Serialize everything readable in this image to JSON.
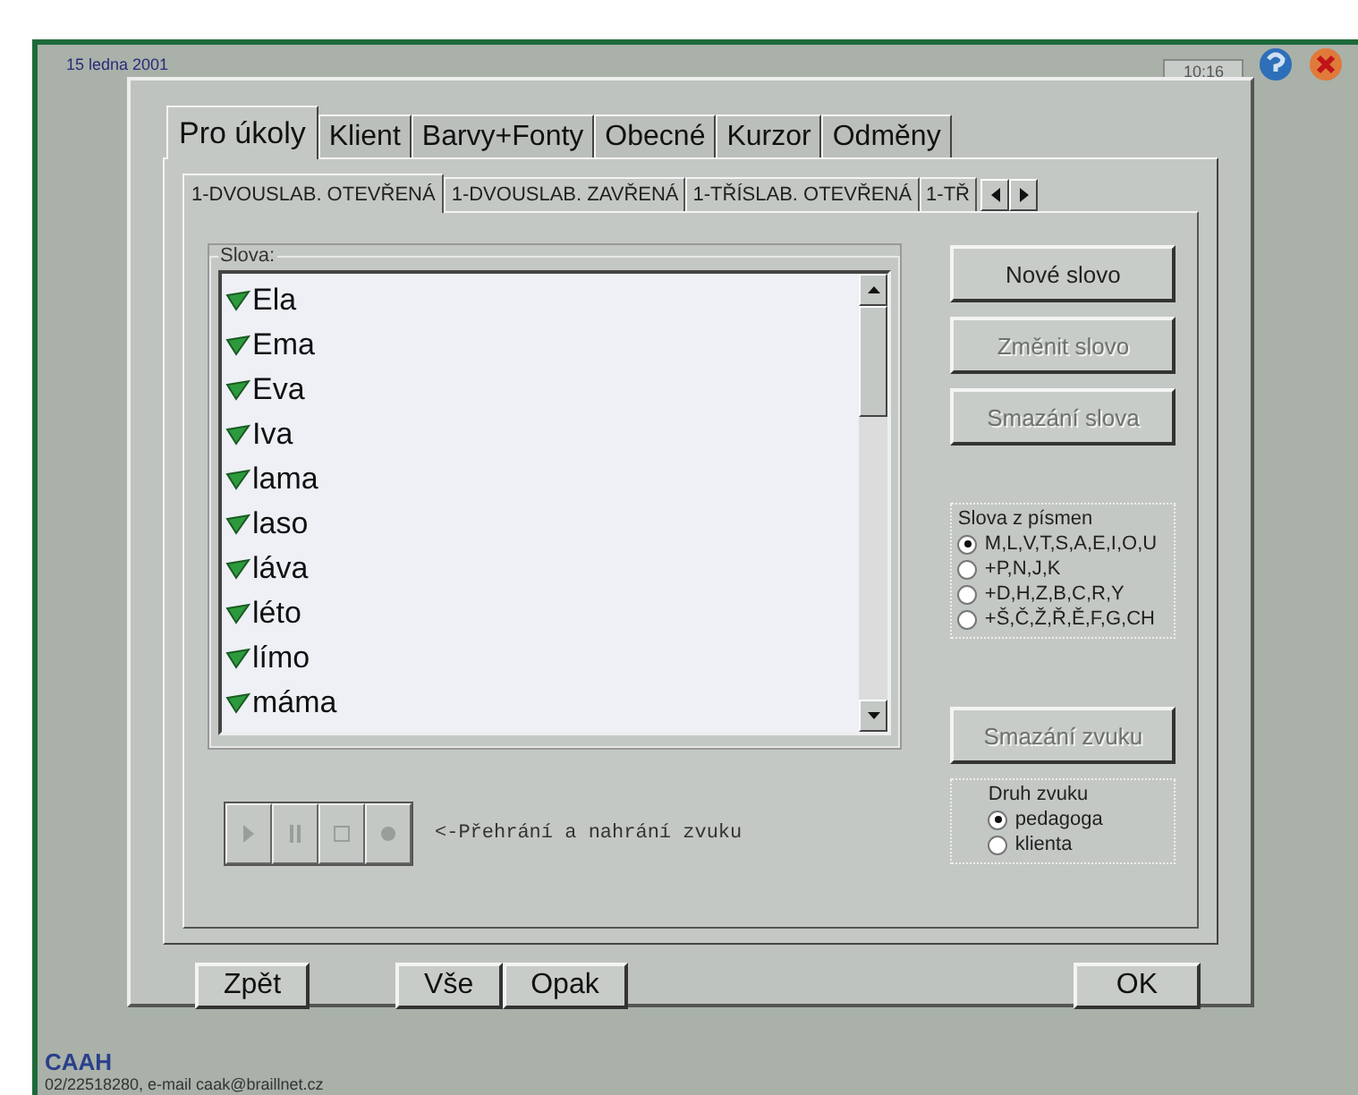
{
  "header": {
    "date": "15 ledna 2001",
    "time": "10:16"
  },
  "tabs": [
    {
      "label": "Pro úkoly",
      "selected": true
    },
    {
      "label": "Klient",
      "selected": false
    },
    {
      "label": "Barvy+Fonty",
      "selected": false
    },
    {
      "label": "Obecné",
      "selected": false
    },
    {
      "label": "Kurzor",
      "selected": false
    },
    {
      "label": "Odměny",
      "selected": false
    }
  ],
  "subtabs": [
    {
      "label": "1-DVOUSLAB. OTEVŘENÁ",
      "selected": true
    },
    {
      "label": "1-DVOUSLAB. ZAVŘENÁ",
      "selected": false
    },
    {
      "label": "1-TŘÍSLAB. OTEVŘENÁ",
      "selected": false
    },
    {
      "label": "1-TŘ",
      "selected": false
    }
  ],
  "words": {
    "label": "Slova:",
    "items": [
      {
        "text": "Ela",
        "checked": true
      },
      {
        "text": "Ema",
        "checked": true
      },
      {
        "text": "Eva",
        "checked": true
      },
      {
        "text": "Iva",
        "checked": true
      },
      {
        "text": "lama",
        "checked": true
      },
      {
        "text": "laso",
        "checked": true
      },
      {
        "text": "láva",
        "checked": true
      },
      {
        "text": "léto",
        "checked": true
      },
      {
        "text": "límo",
        "checked": true
      },
      {
        "text": "máma",
        "checked": true
      }
    ]
  },
  "word_buttons": [
    {
      "label": "Nové slovo",
      "disabled": false
    },
    {
      "label": "Změnit slovo",
      "disabled": true
    },
    {
      "label": "Smazání slova",
      "disabled": true
    }
  ],
  "letters": {
    "label": "Slova z písmen",
    "options": [
      {
        "label": "M,L,V,T,S,A,E,I,O,U",
        "selected": true
      },
      {
        "label": "+P,N,J,K",
        "selected": false
      },
      {
        "label": "+D,H,Z,B,C,R,Y",
        "selected": false
      },
      {
        "label": "+Š,Č,Ž,Ř,Ě,F,G,CH",
        "selected": false
      }
    ]
  },
  "sound_button": {
    "label": "Smazání zvuku",
    "disabled": true
  },
  "sound_type": {
    "label": "Druh zvuku",
    "options": [
      {
        "label": "pedagoga",
        "selected": true
      },
      {
        "label": "klienta",
        "selected": false
      }
    ]
  },
  "media": {
    "buttons": [
      {
        "kind": "play"
      },
      {
        "kind": "pause"
      },
      {
        "kind": "stop"
      },
      {
        "kind": "record"
      }
    ],
    "label": "<-Přehrání a nahrání zvuku"
  },
  "footer_buttons": {
    "back": "Zpět",
    "all": "Vše",
    "repeat": "Opak",
    "ok": "OK"
  },
  "footer": {
    "brand": "CAAH",
    "contact": "02/22518280, e-mail caak@braillnet.cz"
  }
}
